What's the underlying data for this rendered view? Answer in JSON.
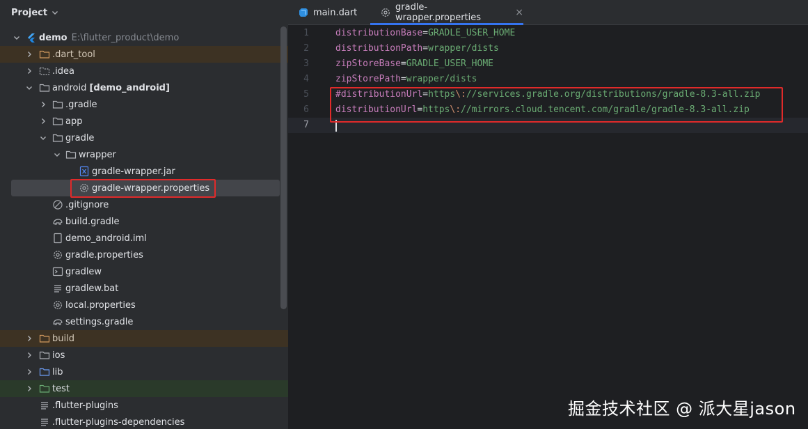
{
  "project_panel": {
    "title": "Project",
    "tree": [
      {
        "label": "demo",
        "path": "E:\\flutter_product\\demo",
        "icon": "flutter-icon",
        "expanded": true
      },
      {
        "label": ".dart_tool",
        "icon": "folder-icon",
        "expanded": false,
        "excluded": true
      },
      {
        "label": ".idea",
        "icon": "folder-icon",
        "expanded": false
      },
      {
        "label": "android",
        "module": "[demo_android]",
        "icon": "folder-icon",
        "expanded": true
      },
      {
        "label": ".gradle",
        "icon": "folder-icon",
        "expanded": false
      },
      {
        "label": "app",
        "icon": "folder-icon",
        "expanded": false
      },
      {
        "label": "gradle",
        "icon": "folder-icon",
        "expanded": true
      },
      {
        "label": "wrapper",
        "icon": "folder-icon",
        "expanded": true
      },
      {
        "label": "gradle-wrapper.jar",
        "icon": "jar-icon"
      },
      {
        "label": "gradle-wrapper.properties",
        "icon": "gear-icon",
        "selected": true
      },
      {
        "label": ".gitignore",
        "icon": "ignore-icon"
      },
      {
        "label": "build.gradle",
        "icon": "gradle-icon"
      },
      {
        "label": "demo_android.iml",
        "icon": "file-icon"
      },
      {
        "label": "gradle.properties",
        "icon": "gear-icon"
      },
      {
        "label": "gradlew",
        "icon": "terminal-icon"
      },
      {
        "label": "gradlew.bat",
        "icon": "text-file-icon"
      },
      {
        "label": "local.properties",
        "icon": "gear-icon"
      },
      {
        "label": "settings.gradle",
        "icon": "gradle-icon"
      },
      {
        "label": "build",
        "icon": "folder-icon",
        "expanded": false,
        "excluded": true
      },
      {
        "label": "ios",
        "icon": "folder-icon",
        "expanded": false
      },
      {
        "label": "lib",
        "icon": "folder-icon",
        "expanded": false
      },
      {
        "label": "test",
        "icon": "folder-icon",
        "expanded": false,
        "test": true
      },
      {
        "label": ".flutter-plugins",
        "icon": "text-file-icon"
      },
      {
        "label": ".flutter-plugins-dependencies",
        "icon": "text-file-icon"
      }
    ]
  },
  "editor": {
    "tabs": [
      {
        "label": "main.dart",
        "icon": "dart-icon",
        "active": false
      },
      {
        "label": "gradle-wrapper.properties",
        "icon": "gear-icon",
        "active": true,
        "close": "×"
      }
    ],
    "lines": [
      {
        "num": "1",
        "key": "distributionBase",
        "value": "GRADLE_USER_HOME"
      },
      {
        "num": "2",
        "key": "distributionPath",
        "value": "wrapper/dists"
      },
      {
        "num": "3",
        "key": "zipStoreBase",
        "value": "GRADLE_USER_HOME"
      },
      {
        "num": "4",
        "key": "zipStorePath",
        "value": "wrapper/dists"
      },
      {
        "num": "5",
        "key": "#distributionUrl",
        "value_pre": "https",
        "esc": "\\:",
        "value_post": "//services.gradle.org/distributions/gradle-8.3-all.zip"
      },
      {
        "num": "6",
        "key": "distributionUrl",
        "value_pre": "https",
        "esc": "\\:",
        "value_post": "//mirrors.cloud.tencent.com/gradle/gradle-8.3-all.zip"
      },
      {
        "num": "7",
        "key": "",
        "value": ""
      }
    ]
  },
  "watermark": "掘金技术社区 @ 派大星jason",
  "colors": {
    "panel_bg": "#2b2d30",
    "editor_bg": "#1e1f22",
    "highlight": "#e02a2a",
    "key": "#c77dbb",
    "value": "#6aab73",
    "accent": "#3574f0"
  }
}
